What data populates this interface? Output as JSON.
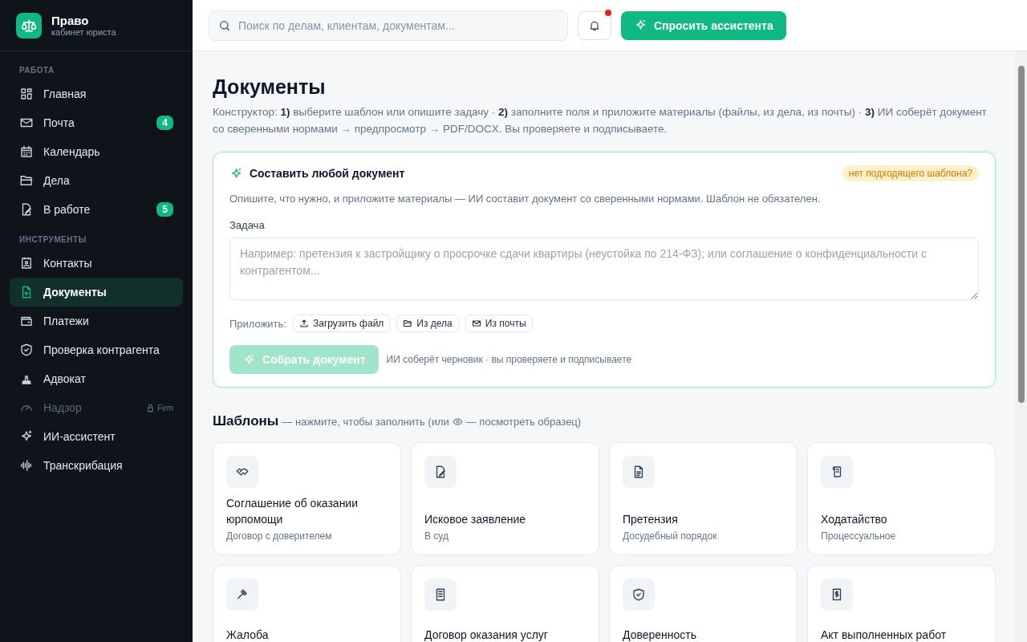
{
  "brand": {
    "name": "Право",
    "subtitle": "кабинет юриста"
  },
  "sidebar": {
    "sections": [
      {
        "title": "РАБОТА",
        "items": [
          {
            "label": "Главная",
            "selected": false,
            "disabled": false
          },
          {
            "label": "Почта",
            "badge": "4",
            "selected": false,
            "disabled": false
          },
          {
            "label": "Календарь",
            "selected": false,
            "disabled": false
          },
          {
            "label": "Дела",
            "selected": false,
            "disabled": false
          },
          {
            "label": "В работе",
            "badge": "5",
            "selected": false,
            "disabled": false
          }
        ]
      },
      {
        "title": "ИНСТРУМЕНТЫ",
        "items": [
          {
            "label": "Контакты",
            "selected": false,
            "disabled": false
          },
          {
            "label": "Документы",
            "selected": true,
            "disabled": false
          },
          {
            "label": "Платежи",
            "selected": false,
            "disabled": false
          },
          {
            "label": "Проверка контрагента",
            "selected": false,
            "disabled": false
          },
          {
            "label": "Адвокат",
            "selected": false,
            "disabled": false
          },
          {
            "label": "Надзор",
            "selected": false,
            "disabled": true,
            "locked_tag": "Firm"
          },
          {
            "label": "ИИ-ассистент",
            "selected": false,
            "disabled": false
          },
          {
            "label": "Транскрибация",
            "selected": false,
            "disabled": false
          }
        ]
      }
    ]
  },
  "topbar": {
    "search": {
      "placeholder": "Поиск по делам, клиентам, документам..."
    },
    "notifications": {
      "unread": true
    },
    "assistant_button": "Спросить ассистента"
  },
  "page": {
    "title": "Документы",
    "description": "Конструктор: **1)** выберите шаблон или опишите задачу · **2)** заполните поля и приложите материалы (файлы, из дела, из почты) · **3)** ИИ соберёт документ со сверенными нормами → предпросмотр → PDF/DOCX. Вы проверяете и подписываете."
  },
  "composer": {
    "title": "Составить любой документ",
    "tag": "нет подходящего шаблона?",
    "description": "Опишите, что нужно, и приложите материалы — ИИ составит документ со сверенными нормами. Шаблон не обязателен.",
    "field_label": "Задача",
    "placeholder": "Например: претензия к застройщику о просрочке сдачи квартиры (неустойка по 214-ФЗ); или соглашение о конфиденциальности с контрагентом...",
    "attach_label": "Приложить:",
    "attach_buttons": [
      "Загрузить файл",
      "Из дела",
      "Из почты"
    ],
    "submit": {
      "label": "Собрать документ",
      "disabled": true
    },
    "hint": "ИИ соберёт черновик · вы проверяете и подписываете"
  },
  "templates": {
    "title": "Шаблоны",
    "hint_before": "— нажмите, чтобы заполнить (или",
    "hint_after": "— посмотреть образец)",
    "items": [
      {
        "title": "Соглашение об оказании юрпомощи",
        "subtitle": "Договор с доверителем"
      },
      {
        "title": "Исковое заявление",
        "subtitle": "В суд"
      },
      {
        "title": "Претензия",
        "subtitle": "Досудебный порядок"
      },
      {
        "title": "Ходатайство",
        "subtitle": "Процессуальное"
      },
      {
        "title": "Жалоба"
      },
      {
        "title": "Договор оказания услуг"
      },
      {
        "title": "Доверенность"
      },
      {
        "title": "Акт выполненных работ"
      }
    ]
  }
}
